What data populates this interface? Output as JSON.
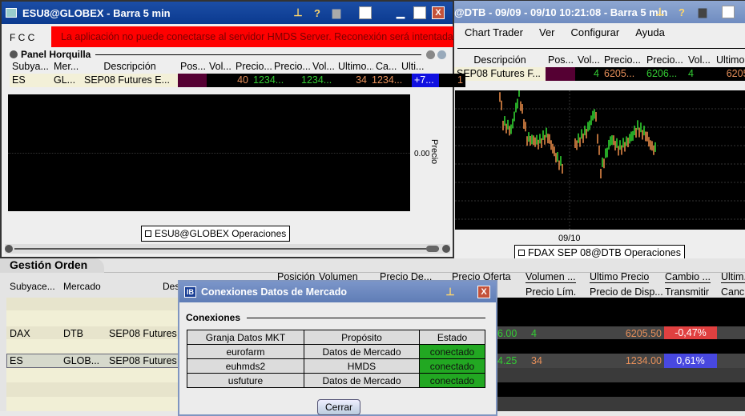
{
  "right_window": {
    "title": "@DTB - 09/09 - 09/10 10:21:08  - Barra 5 min",
    "menu": [
      "Chart Trader",
      "Ver",
      "Configurar",
      "Ayuda"
    ],
    "headers": [
      "Descripción",
      "Pos...",
      "Vol...",
      "Precio...",
      "Precio...",
      "Vol...",
      "Ultimo"
    ],
    "row": [
      "SEP08 Futures F...",
      "",
      "4",
      "6205...",
      "6206...",
      "4",
      "6205."
    ],
    "date_label": "09/10",
    "legend": "FDAX SEP 08@DTB Operaciones"
  },
  "left_window": {
    "title": "ESU8@GLOBEX - Barra 5 min",
    "menu_fragment": "F C C",
    "error": "La aplicación no puede conectarse al servidor HMDS Server. Reconexión será intentada.",
    "panel_title": "Panel Horquilla",
    "headers": [
      "Subya...",
      "Mer...",
      "Descripción",
      "Pos...",
      "Vol...",
      "Precio...",
      "Precio...",
      "Vol...",
      "Ultimo...",
      "Ca...",
      "Ulti..."
    ],
    "row": [
      "ES",
      "GL...",
      "SEP08 Futures E...",
      "",
      "40",
      "1234...",
      "1234...",
      "34",
      "1234...",
      "+7...",
      "1"
    ],
    "price_tick": "0.00",
    "axis_label": "Precio",
    "legend": "ESU8@GLOBEX Operaciones"
  },
  "orders": {
    "title": "Gestión Orden",
    "headers_left": [
      "Subyace...",
      "Mercado",
      "Des"
    ],
    "headers_top": [
      "Posición",
      "Volumen",
      "Precio De...",
      "Precio Oferta",
      "Volumen ...",
      "Ultimo Precio",
      "Cambio ...",
      "Ultim."
    ],
    "headers_bottom": [
      "Precio Lím.",
      "Precio de Disp...",
      "Transmitir",
      "Canc."
    ],
    "rows": [
      {
        "sub": "DAX",
        "mkt": "DTB",
        "desc": "SEP08 Futures",
        "offer": "6.00",
        "vol": "4",
        "last": "6205.50",
        "chg": "-0,47%"
      },
      {
        "sub": "ES",
        "mkt": "GLOB...",
        "desc": "SEP08 Futures",
        "offer": "4.25",
        "vol": "34",
        "last": "1234.00",
        "chg": "0,61%"
      }
    ]
  },
  "dialog": {
    "title": "Conexiones Datos de Mercado",
    "section": "Conexiones",
    "headers": [
      "Granja Datos MKT",
      "Propósito",
      "Estado"
    ],
    "rows": [
      [
        "eurofarm",
        "Datos de Mercado",
        "conectado"
      ],
      [
        "euhmds2",
        "HMDS",
        "conectado"
      ],
      [
        "usfuture",
        "Datos de Mercado",
        "conectado"
      ]
    ],
    "close_label": "Cerrar"
  },
  "colors": {
    "error_bg": "#ff0000",
    "connected": "#22a822",
    "negative": "#e04040",
    "positive": "#4848e0",
    "position": "#550033"
  }
}
